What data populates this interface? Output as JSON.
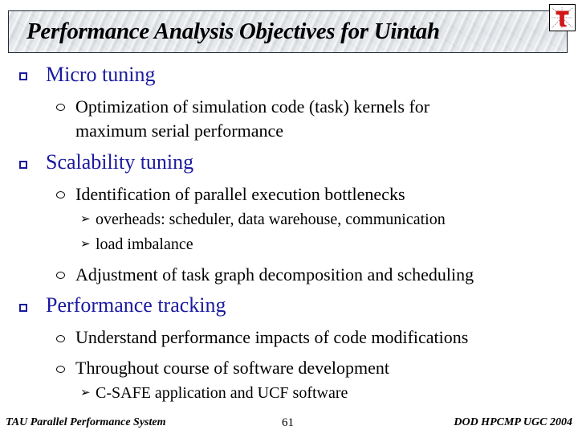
{
  "slide": {
    "title": "Performance Analysis Objectives for Uintah",
    "logo_icon": "tau-logo-icon",
    "bullets": [
      {
        "label": "Micro tuning",
        "children": [
          {
            "lines": [
              "Optimization of simulation code (task) kernels for",
              "maximum serial performance"
            ],
            "children": []
          }
        ]
      },
      {
        "label": "Scalability tuning",
        "children": [
          {
            "lines": [
              "Identification of parallel execution bottlenecks"
            ],
            "children": [
              "overheads: scheduler, data warehouse, communication",
              "load imbalance"
            ]
          },
          {
            "lines": [
              "Adjustment of task graph decomposition and scheduling"
            ],
            "children": []
          }
        ]
      },
      {
        "label": "Performance tracking",
        "children": [
          {
            "lines": [
              "Understand performance impacts of code modifications"
            ],
            "children": []
          },
          {
            "lines": [
              "Throughout course of software development"
            ],
            "children": [
              "C-SAFE application and UCF software"
            ]
          }
        ]
      }
    ]
  },
  "footer": {
    "left": "TAU Parallel Performance System",
    "page_number": "61",
    "right": "DOD HPCMP UGC 2004"
  },
  "colors": {
    "level1_text": "#1a1aa0",
    "body_text": "#000000"
  }
}
